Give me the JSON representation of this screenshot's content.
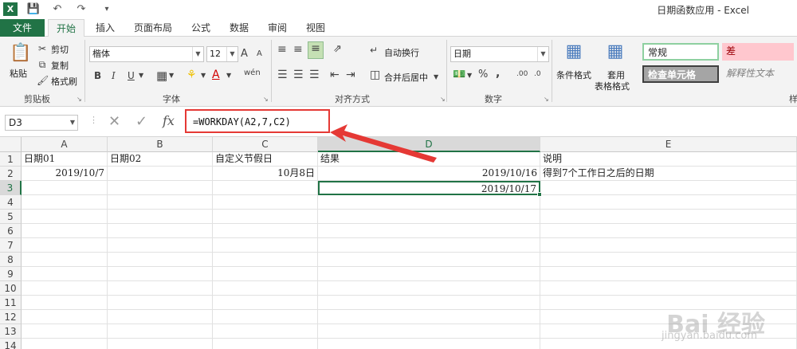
{
  "titlebar": {
    "app_icon": "X",
    "title": "日期函数应用 - Excel",
    "save_icon": "save-icon",
    "undo_icon": "undo-icon",
    "redo_icon": "redo-icon"
  },
  "tabs": {
    "file": "文件",
    "items": [
      "开始",
      "插入",
      "页面布局",
      "公式",
      "数据",
      "审阅",
      "视图"
    ],
    "active": "开始"
  },
  "ribbon": {
    "clipboard": {
      "paste": "粘贴",
      "cut": "剪切",
      "copy": "复制",
      "format_painter": "格式刷",
      "group": "剪贴板"
    },
    "font": {
      "name": "楷体",
      "size": "12",
      "bold": "B",
      "italic": "I",
      "underline": "U",
      "grow": "A",
      "shrink": "A",
      "phonetic": "wén",
      "group": "字体"
    },
    "alignment": {
      "wrap": "自动换行",
      "merge": "合并后居中",
      "group": "对齐方式"
    },
    "number": {
      "format": "日期",
      "percent": "%",
      "comma": ",",
      "inc_decimal": ".00",
      "dec_decimal": ".0",
      "group": "数字"
    },
    "styles": {
      "conditional": "条件格式",
      "table_format_1": "套用",
      "table_format_2": "表格格式",
      "normal": "常规",
      "bad": "差",
      "check_cell": "检查单元格",
      "explanatory": "解释性文本",
      "group_partial": "样"
    }
  },
  "formula_bar": {
    "name_box": "D3",
    "cancel": "✕",
    "enter": "✓",
    "fx": "fx",
    "formula": "=WORKDAY(A2,7,C2)"
  },
  "sheet": {
    "columns": [
      "A",
      "B",
      "C",
      "D",
      "E"
    ],
    "rows": [
      "1",
      "2",
      "3",
      "4",
      "5",
      "6",
      "7",
      "8",
      "9",
      "10",
      "11",
      "12",
      "13",
      "14"
    ],
    "cells": {
      "A1": "日期01",
      "B1": "日期02",
      "C1": "自定义节假日",
      "D1": "结果",
      "E1": "说明",
      "A2": "2019/10/7",
      "C2": "10月8日",
      "D2": "2019/10/16",
      "E2": "得到7个工作日之后的日期",
      "D3": "2019/10/17"
    },
    "active_cell": "D3"
  },
  "watermark": {
    "text": "Bai 经验",
    "sub": "jingyan.baidu.com"
  },
  "colors": {
    "excel_green": "#217346",
    "annotation_red": "#e53935",
    "bad_style_bg": "#ffc7ce",
    "bad_style_fg": "#9c0006"
  }
}
